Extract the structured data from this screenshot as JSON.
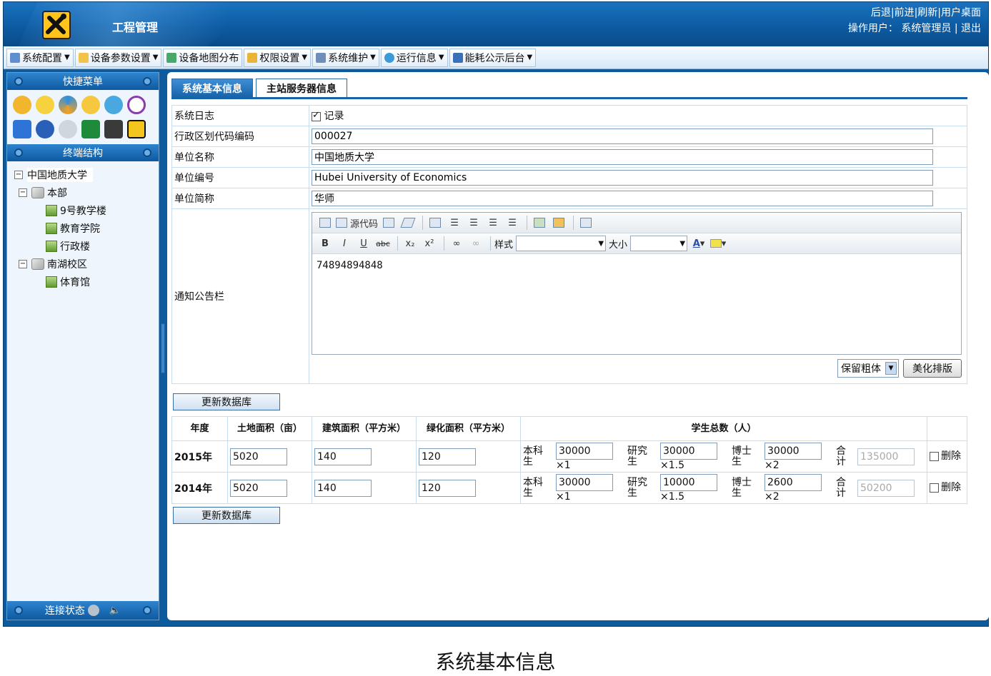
{
  "header": {
    "title": "工程管理",
    "nav_links": [
      "后退",
      "前进",
      "刷新",
      "用户桌面"
    ],
    "operator_label": "操作用户：",
    "operator_name": "系统管理员",
    "logout": "退出"
  },
  "menubar": {
    "items": [
      {
        "label": "系统配置",
        "icon": "config-icon"
      },
      {
        "label": "设备参数设置",
        "icon": "folder-icon"
      },
      {
        "label": "设备地图分布",
        "icon": "map-icon"
      },
      {
        "label": "权限设置",
        "icon": "key-icon"
      },
      {
        "label": "系统维护",
        "icon": "users-icon"
      },
      {
        "label": "运行信息",
        "icon": "globe-icon"
      },
      {
        "label": "能耗公示后台",
        "icon": "screen-icon"
      }
    ]
  },
  "sidebar": {
    "quick_menu_title": "快捷菜单",
    "quick_icons": [
      "settings-icon",
      "pencil-icon",
      "recycle-icon",
      "star-icon",
      "person-icon",
      "power-icon",
      "wave-icon",
      "globe-icon",
      "disc-icon",
      "co-icon",
      "lamp-icon",
      "tools-icon"
    ],
    "terminal_title": "终端结构",
    "tree": {
      "root": "中国地质大学",
      "branches": [
        {
          "label": "本部",
          "children": [
            "9号教学楼",
            "教育学院",
            "行政楼"
          ]
        },
        {
          "label": "南湖校区",
          "children": [
            "体育馆"
          ]
        }
      ]
    },
    "footer_label": "连接状态"
  },
  "tabs": [
    "系统基本信息",
    "主站服务器信息"
  ],
  "form": {
    "system_log_label": "系统日志",
    "system_log_check": "记录",
    "region_code_label": "行政区划代码编码",
    "region_code_value": "000027",
    "unit_name_label": "单位名称",
    "unit_name_value": "中国地质大学",
    "unit_id_label": "单位编号",
    "unit_id_value": "Hubei University of Economics",
    "unit_abbr_label": "单位简称",
    "unit_abbr_value": "华师",
    "notice_label": "通知公告栏"
  },
  "editor": {
    "source_label": "源代码",
    "style_label": "样式",
    "size_label": "大小",
    "font_color": "A",
    "body": "74894894848",
    "format_select": "保留粗体",
    "beautify_button": "美化排版"
  },
  "update_button": "更新数据库",
  "stats": {
    "headers": {
      "year": "年度",
      "land": "土地面积（亩）",
      "building": "建筑面积（平方米）",
      "green": "绿化面积（平方米）",
      "students": "学生总数（人）"
    },
    "undergrad_label": "本科生",
    "grad_label": "研究生",
    "phd_label": "博士生",
    "total_label": "合计",
    "delete_label": "删除",
    "rows": [
      {
        "year": "2015年",
        "land": "5020",
        "building": "140",
        "green": "120",
        "undergrad": "30000",
        "undergrad_w": "×1",
        "grad": "30000",
        "grad_w": "×1.5",
        "phd": "30000",
        "phd_w": "×2",
        "total": "135000"
      },
      {
        "year": "2014年",
        "land": "5020",
        "building": "140",
        "green": "120",
        "undergrad": "30000",
        "undergrad_w": "×1",
        "grad": "10000",
        "grad_w": "×1.5",
        "phd": "2600",
        "phd_w": "×2",
        "total": "50200"
      }
    ]
  },
  "caption": "系统基本信息",
  "colors": {
    "header_blue": "#0d5ba3",
    "tab_blue": "#1763aa"
  }
}
